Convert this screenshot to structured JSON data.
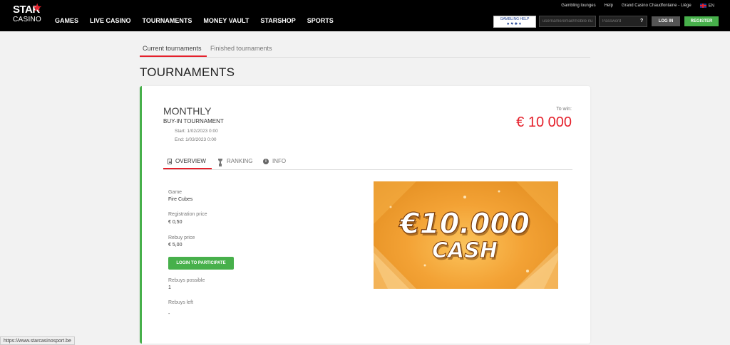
{
  "brand": {
    "logo_text": "STAR",
    "logo_sub": "CASINO"
  },
  "nav": [
    "GAMES",
    "LIVE CASINO",
    "TOURNAMENTS",
    "MONEY VAULT",
    "STARSHOP",
    "SPORTS"
  ],
  "toplinks": {
    "lounges": "Gambling lounges",
    "help": "Help",
    "venue": "Grand Casino Chaudfontaine - Liège",
    "lang": "EN"
  },
  "gambling_help": {
    "label": "GAMBLING HELP",
    "suits": "♠♥♣♦"
  },
  "login": {
    "username_placeholder": "username/email/mobile number",
    "password_placeholder": "Password",
    "help_glyph": "?",
    "login_label": "LOG IN",
    "register_label": "REGISTER"
  },
  "subtabs": {
    "current": "Current tournaments",
    "finished": "Finished tournaments"
  },
  "page_title": "TOURNAMENTS",
  "tournament": {
    "name": "MONTHLY",
    "type": "BUY-IN TOURNAMENT",
    "start": "Start: 1/02/2023 0:00",
    "end": "End: 1/03/2023 0:00",
    "to_win_label": "To win:",
    "to_win_amount": "€ 10 000",
    "tabs": {
      "overview": "OVERVIEW",
      "ranking": "RANKING",
      "info": "INFO"
    },
    "game_label": "Game",
    "game_value": "Fire Cubes",
    "reg_label": "Registration price",
    "reg_value": "€ 0,50",
    "rebuy_label": "Rebuy price",
    "rebuy_value": "€ 5,00",
    "participate_label": "LOGIN TO PARTICIPATE",
    "rebuys_possible_label": "Rebuys possible",
    "rebuys_possible_value": "1",
    "rebuys_left_label": "Rebuys left",
    "rebuys_left_value": "-",
    "promo_line1": "€10.000",
    "promo_line2": "CASH"
  },
  "status_url": "https://www.starcasinosport.be"
}
